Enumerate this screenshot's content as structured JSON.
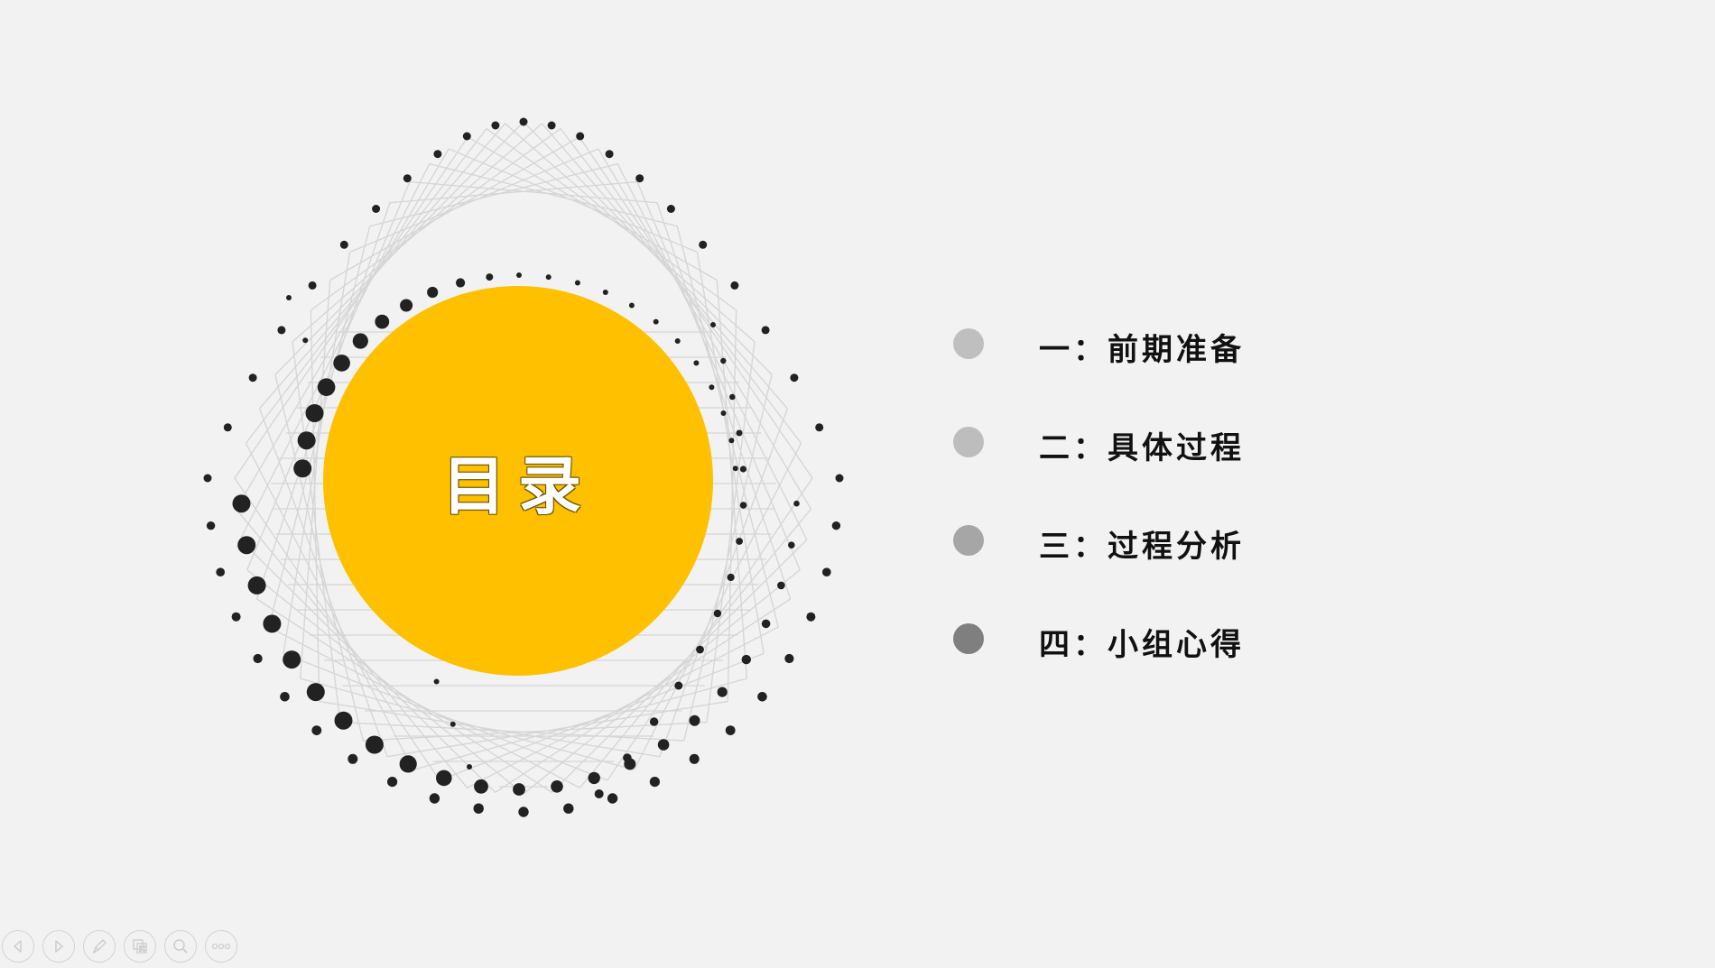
{
  "slide": {
    "title": "目录",
    "colors": {
      "background": "#f2f2f2",
      "accent_circle": "#ffc000",
      "dot_pattern": "#222222",
      "mesh_lines": "#d6d6d6"
    }
  },
  "menu": {
    "items": [
      {
        "label": "一：前期准备",
        "dot_color": "#bfbfbf"
      },
      {
        "label": "二：具体过程",
        "dot_color": "#bdbdbd"
      },
      {
        "label": "三：过程分析",
        "dot_color": "#a6a6a6"
      },
      {
        "label": "四：小组心得",
        "dot_color": "#7f7f7f"
      }
    ]
  },
  "toolbar": {
    "buttons": [
      {
        "icon": "previous-arrow-icon"
      },
      {
        "icon": "next-arrow-icon"
      },
      {
        "icon": "pen-icon"
      },
      {
        "icon": "slides-grid-icon"
      },
      {
        "icon": "zoom-icon"
      },
      {
        "icon": "more-options-icon"
      }
    ]
  }
}
